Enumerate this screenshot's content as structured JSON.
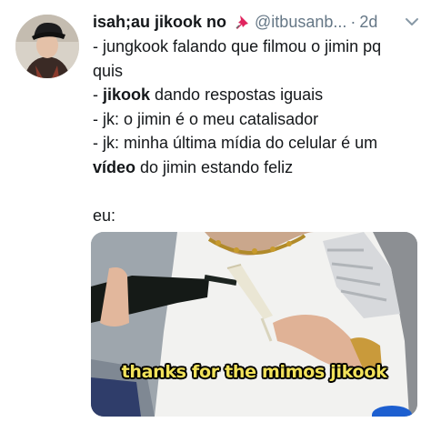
{
  "tweet": {
    "display_name": "isah;au jikook no",
    "handle": "@itbusanb...",
    "separator": "·",
    "time": "2d",
    "pin_icon": "pushpin-icon",
    "caret_icon": "chevron-down-icon",
    "body": {
      "line1": "- jungkook falando que filmou o jimin pq",
      "line2": "quis",
      "line3_bold": "jikook",
      "line3_prefix": "- ",
      "line3_rest": " dando respostas iguais",
      "line4": "- jk: o jimin é o meu catalisador",
      "line5": "- jk: minha última mídia do celular é um",
      "line6_bold": "vídeo",
      "line6_rest": " do jimin estando feliz",
      "line7": "eu:"
    },
    "media": {
      "caption": "thanks for the mimos jikook"
    }
  },
  "colors": {
    "text": "#14171a",
    "secondary": "#657786",
    "caption": "#f2e25a",
    "pin": "#e0245e"
  }
}
